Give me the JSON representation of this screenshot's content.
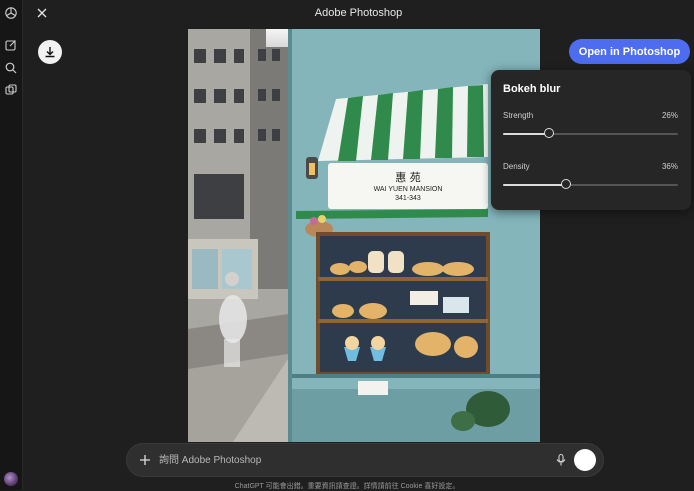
{
  "window": {
    "title": "Adobe Photoshop"
  },
  "sidebar": {
    "icons": [
      "chatgpt-logo-icon",
      "new-chat-icon",
      "search-icon",
      "library-icon"
    ]
  },
  "toolbar": {
    "open_button_label": "Open in Photoshop",
    "download_icon": "download-icon",
    "close_icon": "close-icon"
  },
  "photo": {
    "sign_chinese": "惠 苑",
    "sign_english": "WAI YUEN MANSION",
    "sign_number": "341-343"
  },
  "panel": {
    "title": "Bokeh blur",
    "sliders": [
      {
        "label": "Strength",
        "value_text": "26%",
        "value": 0.26
      },
      {
        "label": "Density",
        "value_text": "36%",
        "value": 0.36
      }
    ]
  },
  "composer": {
    "placeholder": "詢問 Adobe Photoshop"
  },
  "disclaimer": "ChatGPT 可能會出錯。重要資訊請查證。詳情請前往 Cookie 喜好設定。",
  "colors": {
    "accent": "#4d6cf0",
    "panel_bg": "#262626",
    "app_bg": "#1f1f1f"
  }
}
